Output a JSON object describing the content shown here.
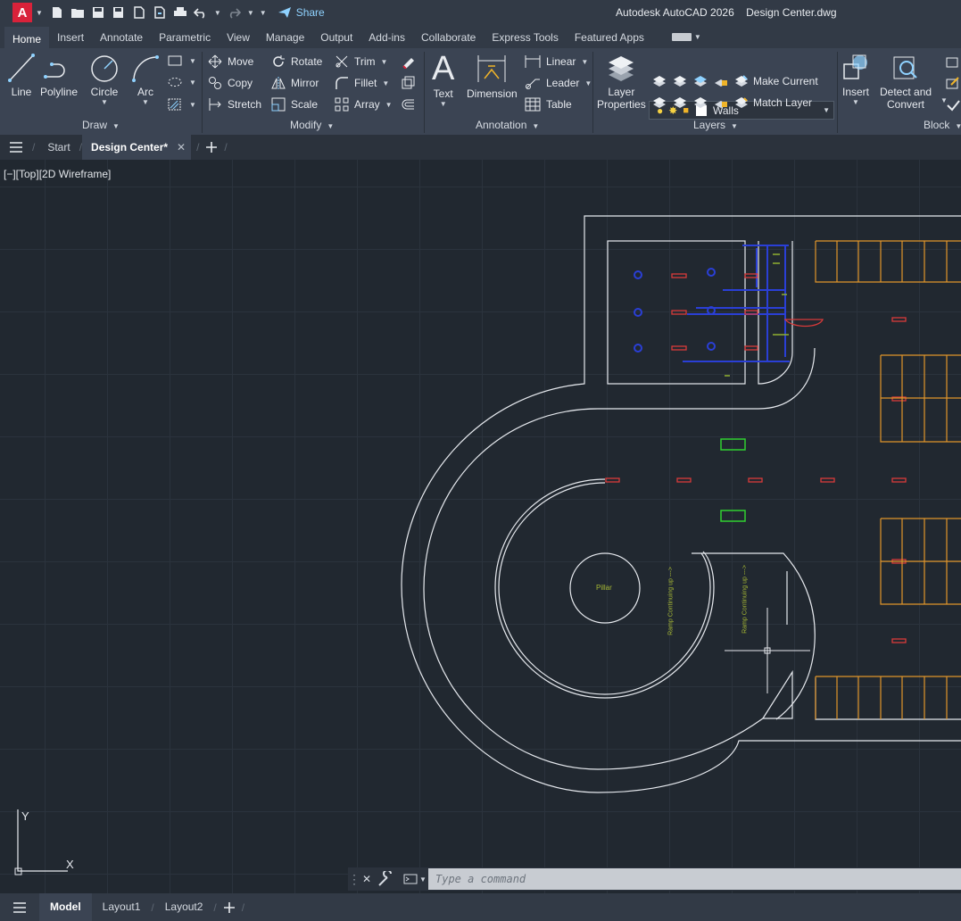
{
  "titlebar": {
    "app_logo": "A",
    "app_title": "Autodesk AutoCAD 2026",
    "doc_title": "Design Center.dwg",
    "share_label": "Share"
  },
  "ribbon_tabs": [
    "Home",
    "Insert",
    "Annotate",
    "Parametric",
    "View",
    "Manage",
    "Output",
    "Add-ins",
    "Collaborate",
    "Express Tools",
    "Featured Apps"
  ],
  "ribbon": {
    "draw": {
      "title": "Draw",
      "line": "Line",
      "polyline": "Polyline",
      "circle": "Circle",
      "arc": "Arc"
    },
    "modify": {
      "title": "Modify",
      "move": "Move",
      "rotate": "Rotate",
      "trim": "Trim",
      "copy": "Copy",
      "mirror": "Mirror",
      "fillet": "Fillet",
      "stretch": "Stretch",
      "scale": "Scale",
      "array": "Array"
    },
    "annotation": {
      "title": "Annotation",
      "text": "Text",
      "dimension": "Dimension",
      "linear": "Linear",
      "leader": "Leader",
      "table": "Table"
    },
    "layers": {
      "title": "Layers",
      "layer_properties_1": "Layer",
      "layer_properties_2": "Properties",
      "current_layer": "Walls",
      "make_current": "Make Current",
      "match_layer": "Match Layer"
    },
    "block": {
      "title": "Block",
      "insert": "Insert",
      "detect_1": "Detect and",
      "detect_2": "Convert"
    }
  },
  "file_tabs": {
    "start": "Start",
    "current": "Design Center*"
  },
  "viewport": {
    "view_control": "[−][Top][2D Wireframe]",
    "pillar_label": "Pillar",
    "ramp_label": "Ramp Continuing up --->",
    "ucs_y": "Y",
    "ucs_x": "X"
  },
  "command_line": {
    "placeholder": "Type a command"
  },
  "layout_tabs": [
    "Model",
    "Layout1",
    "Layout2"
  ],
  "colors": {
    "accent_blue": "#8fd2ff",
    "logo_red": "#d8223a",
    "canvas_bg": "#212830",
    "ribbon_bg": "#3b4453"
  }
}
